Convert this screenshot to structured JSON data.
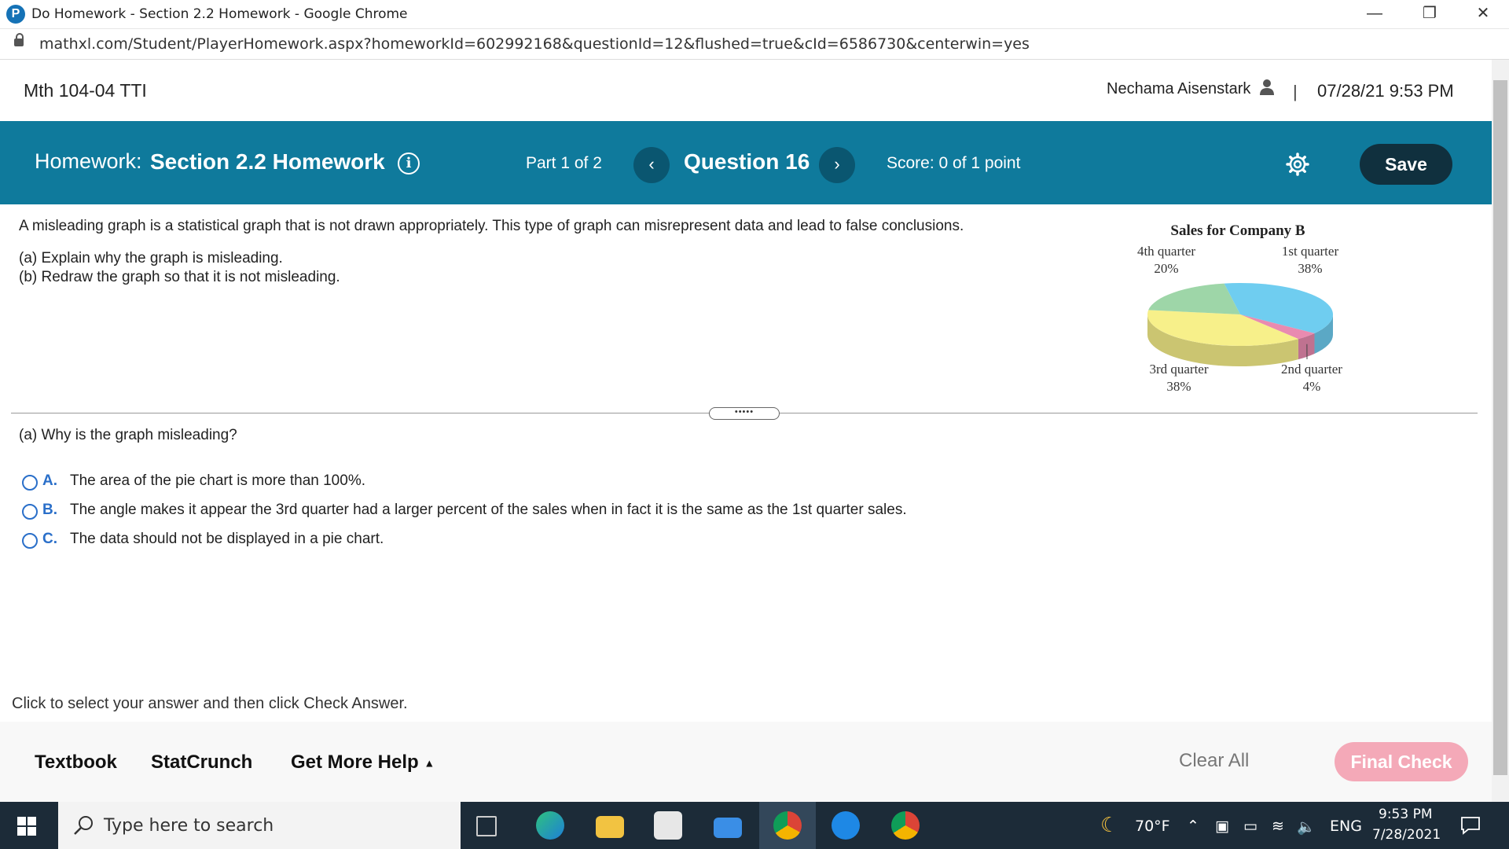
{
  "window": {
    "title": "Do Homework - Section 2.2 Homework - Google Chrome",
    "url": "mathxl.com/Student/PlayerHomework.aspx?homeworkId=602992168&questionId=12&flushed=true&cId=6586730&centerwin=yes"
  },
  "header": {
    "course": "Mth 104-04 TTI",
    "user": "Nechama Aisenstark",
    "separator": "|",
    "datetime": "07/28/21 9:53 PM"
  },
  "banner": {
    "homework_label": "Homework:",
    "homework_name": "Section 2.2 Homework",
    "part": "Part 1 of 2",
    "question": "Question 16",
    "score": "Score: 0 of 1 point",
    "save": "Save"
  },
  "question": {
    "intro": "A misleading graph is a statistical graph that is not drawn appropriately. This type of graph can misrepresent data and lead to false conclusions.",
    "part_a": "(a) Explain why the graph is misleading.",
    "part_b": "(b) Redraw the graph so that it is not misleading.",
    "prompt": "(a) Why is the graph misleading?",
    "options": [
      {
        "letter": "A.",
        "text": "The area of the pie chart is more than 100%."
      },
      {
        "letter": "B.",
        "text": "The angle makes it appear the 3rd quarter had a larger percent of the sales when in fact it is the same as the 1st quarter sales."
      },
      {
        "letter": "C.",
        "text": "The data should not be displayed in a pie chart."
      }
    ],
    "instruction": "Click to select your answer and then click Check Answer."
  },
  "chart_data": {
    "type": "pie",
    "title": "Sales for Company B",
    "categories": [
      "1st quarter",
      "2nd quarter",
      "3rd quarter",
      "4th quarter"
    ],
    "values": [
      38,
      4,
      38,
      20
    ],
    "value_labels": [
      "38%",
      "4%",
      "38%",
      "20%"
    ],
    "colors": [
      "#6fcdf0",
      "#e98bb0",
      "#f7f08a",
      "#9ed6a8"
    ],
    "three_d": true
  },
  "footer": {
    "textbook": "Textbook",
    "statcrunch": "StatCrunch",
    "get_more_help": "Get More Help",
    "clear_all": "Clear All",
    "final_check": "Final Check"
  },
  "taskbar": {
    "search_placeholder": "Type here to search",
    "weather": "70°F",
    "language": "ENG",
    "time": "9:53 PM",
    "date": "7/28/2021"
  }
}
